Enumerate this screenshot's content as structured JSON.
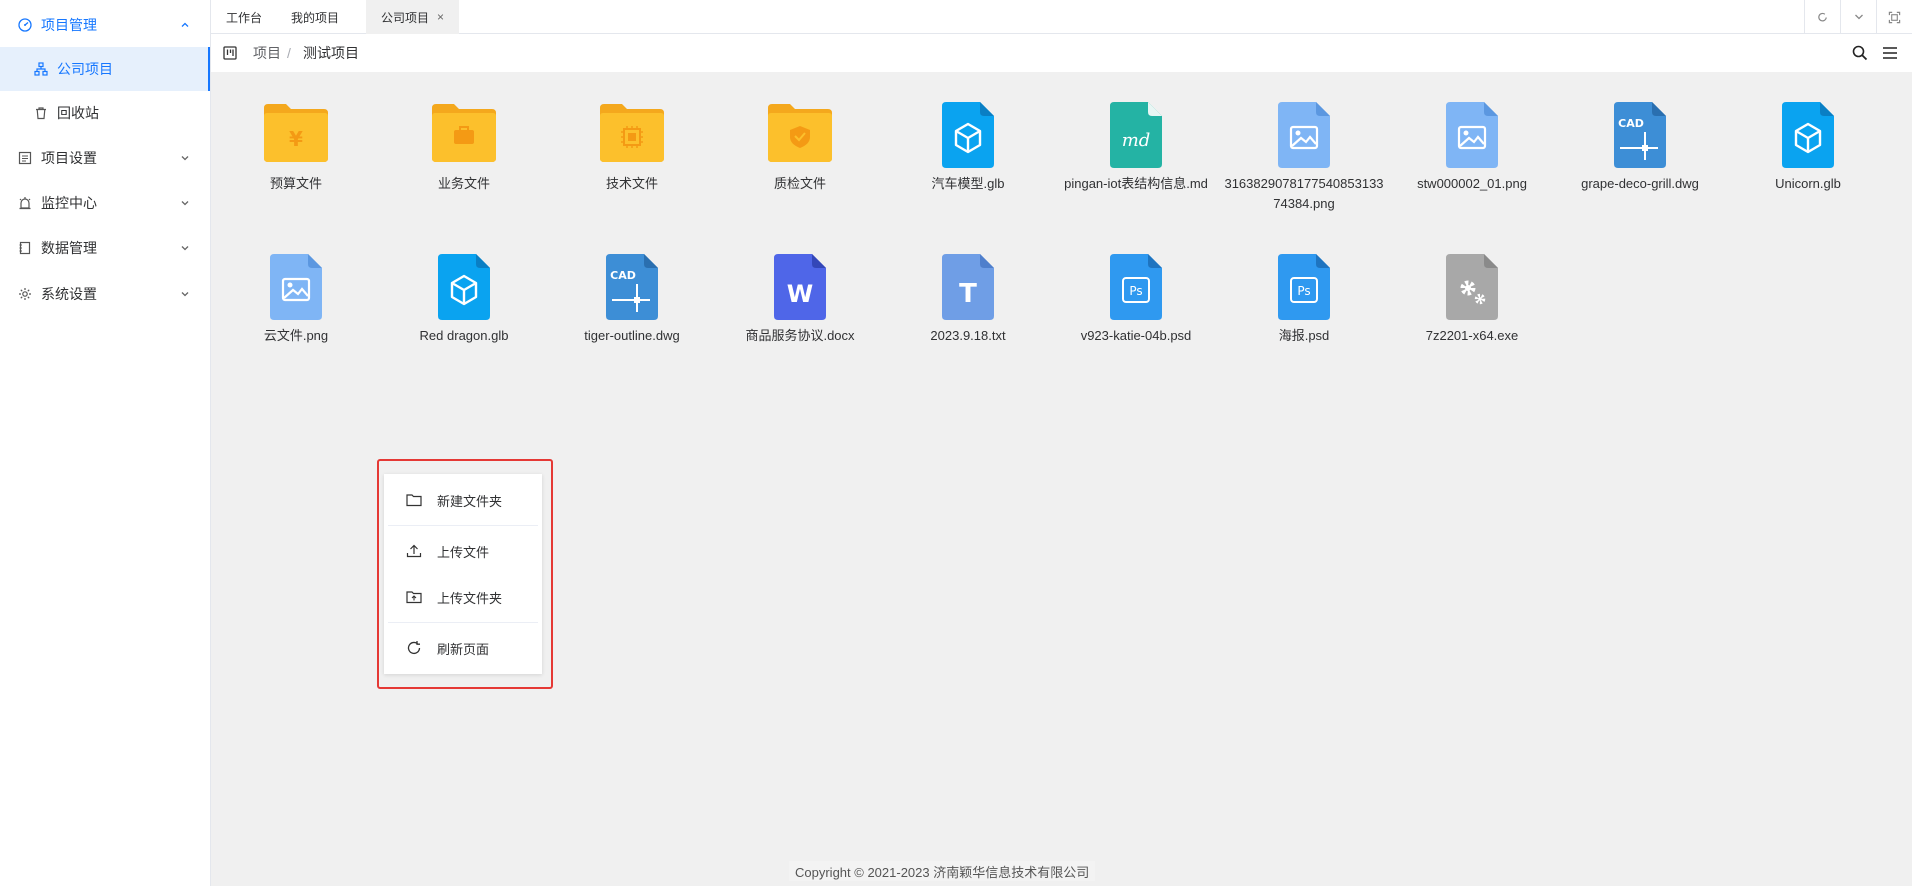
{
  "sidebar": {
    "menu_project": "项目管理",
    "sub_company": "公司项目",
    "sub_recycle": "回收站",
    "menu_settings": "项目设置",
    "menu_monitor": "监控中心",
    "menu_data": "数据管理",
    "menu_system": "系统设置"
  },
  "tabs": {
    "workbench": "工作台",
    "my_projects": "我的项目",
    "company_projects": "公司项目",
    "close_symbol": "×"
  },
  "breadcrumb": {
    "root": "项目",
    "separator": "/",
    "current": "测试项目"
  },
  "files": [
    {
      "name": "预算文件",
      "type": "folder",
      "badge": "¥"
    },
    {
      "name": "业务文件",
      "type": "folder",
      "badge": "briefcase"
    },
    {
      "name": "技术文件",
      "type": "folder",
      "badge": "chip"
    },
    {
      "name": "质检文件",
      "type": "folder",
      "badge": "shield"
    },
    {
      "name": "汽车模型.glb",
      "type": "glb"
    },
    {
      "name": "pingan-iot表结构信息.md",
      "type": "md"
    },
    {
      "name": "316382907817754085313374384.png",
      "type": "png"
    },
    {
      "name": "stw000002_01.png",
      "type": "png"
    },
    {
      "name": "grape-deco-grill.dwg",
      "type": "dwg"
    },
    {
      "name": "Unicorn.glb",
      "type": "glb"
    },
    {
      "name": "云文件.png",
      "type": "png"
    },
    {
      "name": "Red dragon.glb",
      "type": "glb"
    },
    {
      "name": "tiger-outline.dwg",
      "type": "dwg"
    },
    {
      "name": "商品服务协议.docx",
      "type": "docx"
    },
    {
      "name": "2023.9.18.txt",
      "type": "txt"
    },
    {
      "name": "v923-katie-04b.psd",
      "type": "psd"
    },
    {
      "name": "海报.psd",
      "type": "psd"
    },
    {
      "name": "7z2201-x64.exe",
      "type": "exe"
    }
  ],
  "icon_labels": {
    "md": "md",
    "cad": "CAD",
    "word": "W",
    "txt": "T",
    "ps": "Ps"
  },
  "context_menu": {
    "new_folder": "新建文件夹",
    "upload_file": "上传文件",
    "upload_folder": "上传文件夹",
    "refresh": "刷新页面"
  },
  "footer": "Copyright © 2021-2023 济南颖华信息技术有限公司",
  "colors": {
    "accent": "#1677ff",
    "folder": "#fcc02c",
    "glb": "#0aa3f0",
    "md": "#24b3a4",
    "png": "#7fb5f5",
    "dwg": "#3d8ed6",
    "docx": "#4f66e8",
    "txt": "#6f9ee6",
    "psd": "#2f99f0",
    "exe": "#a8a8a8",
    "highlight": "#e53935"
  }
}
